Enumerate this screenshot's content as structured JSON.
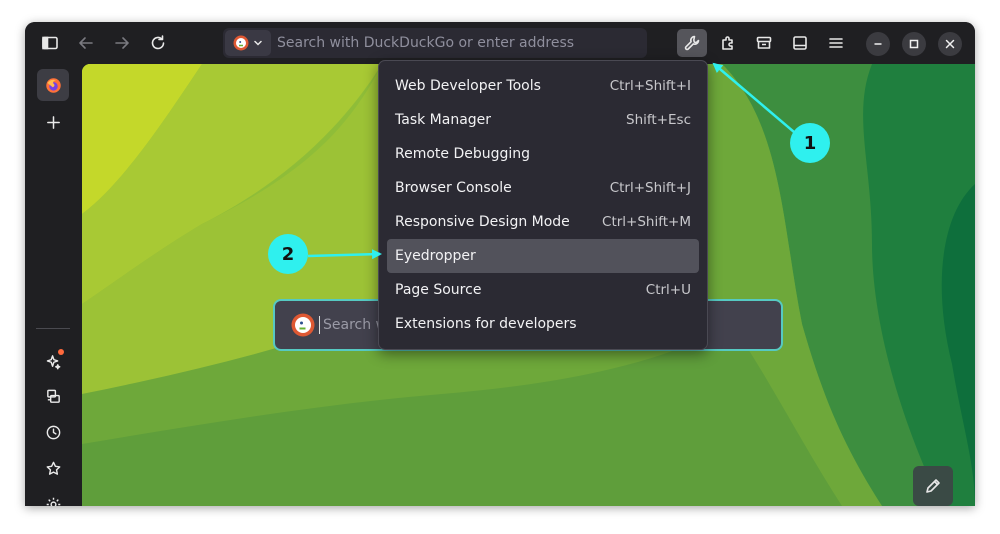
{
  "toolbar": {
    "url_placeholder": "Search with DuckDuckGo or enter address"
  },
  "content": {
    "search_placeholder": "Search w"
  },
  "menu": {
    "items": [
      {
        "label": "Web Developer Tools",
        "shortcut": "Ctrl+Shift+I"
      },
      {
        "label": "Task Manager",
        "shortcut": "Shift+Esc"
      },
      {
        "label": "Remote Debugging",
        "shortcut": ""
      },
      {
        "label": "Browser Console",
        "shortcut": "Ctrl+Shift+J"
      },
      {
        "label": "Responsive Design Mode",
        "shortcut": "Ctrl+Shift+M"
      },
      {
        "label": "Eyedropper",
        "shortcut": ""
      },
      {
        "label": "Page Source",
        "shortcut": "Ctrl+U"
      },
      {
        "label": "Extensions for developers",
        "shortcut": ""
      }
    ]
  },
  "annotations": {
    "badge1": "1",
    "badge2": "2",
    "color": "#2ff0ee"
  },
  "colors": {
    "window_bg": "#1f1f22",
    "menu_bg": "#2b2a33",
    "menu_hover": "#52525b",
    "search_border": "#56c9c2",
    "notification": "#ff6a3d"
  },
  "icons": [
    "sidebar-toggle-icon",
    "back-arrow-icon",
    "forward-arrow-icon",
    "reload-icon",
    "duckduckgo-icon",
    "chevron-down-icon",
    "wrench-icon",
    "extensions-icon",
    "save-to-pocket-icon",
    "tab-manager-icon",
    "hamburger-menu-icon",
    "minimize-icon",
    "maximize-icon",
    "close-icon",
    "firefox-icon",
    "plus-icon",
    "sparkle-icon",
    "synced-tabs-icon",
    "history-icon",
    "bookmark-star-icon",
    "settings-gear-icon",
    "pencil-icon"
  ]
}
